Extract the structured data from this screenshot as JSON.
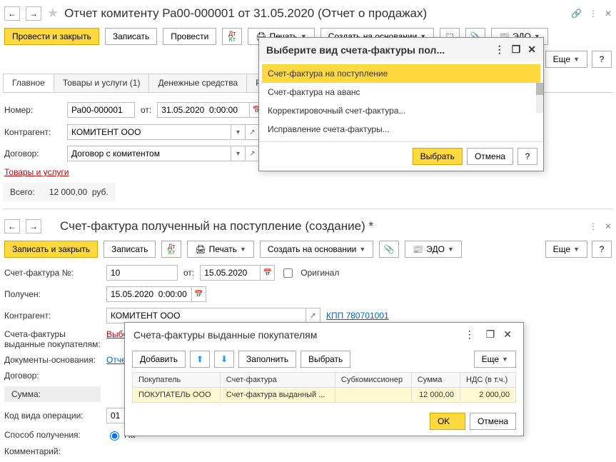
{
  "pane1": {
    "title": "Отчет комитенту Ра00-000001 от 31.05.2020 (Отчет о продажах)",
    "btn_primary": "Провести и закрыть",
    "btn_save": "Записать",
    "btn_post": "Провести",
    "btn_print": "Печать",
    "btn_create_based": "Создать на основании",
    "btn_edo": "ЭДО",
    "btn_more": "Еще",
    "tabs": [
      "Главное",
      "Товары и услуги (1)",
      "Денежные средства",
      "Расчеты"
    ],
    "lbl_number": "Номер:",
    "number": "Ра00-000001",
    "lbl_from": "от:",
    "date": "31.05.2020  0:00:00",
    "lbl_contragent": "Контрагент:",
    "contragent": "КОМИТЕНТ ООО",
    "lbl_contract": "Договор:",
    "contract": "Договор с комитентом",
    "goods_link": "Товары и услуги",
    "lbl_total": "Всего:",
    "total_amount": "12 000,00",
    "currency": "руб."
  },
  "popup1": {
    "title": "Выберите вид счета-фактуры пол...",
    "items": [
      "Счет-фактура на поступление",
      "Счет-фактура на аванс",
      "Корректировочный счет-фактура...",
      "Исправление счета-фактуры..."
    ],
    "btn_select": "Выбрать",
    "btn_cancel": "Отмена"
  },
  "pane2": {
    "title": "Счет-фактура полученный на поступление (создание) *",
    "btn_primary": "Записать и закрыть",
    "btn_save": "Записать",
    "btn_print": "Печать",
    "btn_create_based": "Создать на основании",
    "btn_edo": "ЭДО",
    "btn_more": "Еще",
    "lbl_invoice_no": "Счет-фактура №:",
    "invoice_no": "10",
    "lbl_from": "от:",
    "inv_date": "15.05.2020",
    "lbl_original": "Оригинал",
    "lbl_received": "Получен:",
    "received_date": "15.05.2020  0:00:00",
    "lbl_contragent": "Контрагент:",
    "contragent": "КОМИТЕНТ ООО",
    "kpp_link": "КПП 780701001",
    "lbl_issued": "Счета-фактуры выданные покупателям:",
    "issued_link": "Выбор",
    "lbl_docs": "Документы-основания:",
    "docs_link": "Отчет",
    "lbl_contract": "Договор:",
    "lbl_sum": "Сумма:",
    "lbl_op_code": "Код вида операции:",
    "op_code": "01",
    "lbl_receipt_method": "Способ получения:",
    "receipt_option1": "На",
    "lbl_comment": "Комментарий:"
  },
  "popup2": {
    "title": "Счета-фактуры выданные покупателям",
    "btn_add": "Добавить",
    "btn_fill": "Заполнить",
    "btn_select": "Выбрать",
    "btn_more": "Еще",
    "cols": [
      "Покупатель",
      "Счет-фактура",
      "Субкомиссионер",
      "Сумма",
      "НДС (в т.ч.)"
    ],
    "row": {
      "buyer": "ПОКУПАТЕЛЬ ООО",
      "invoice": "Счет-фактура выданный ...",
      "sub": "",
      "sum": "12 000,00",
      "vat": "2 000,00"
    },
    "btn_ok": "OK",
    "btn_cancel": "Отмена"
  }
}
